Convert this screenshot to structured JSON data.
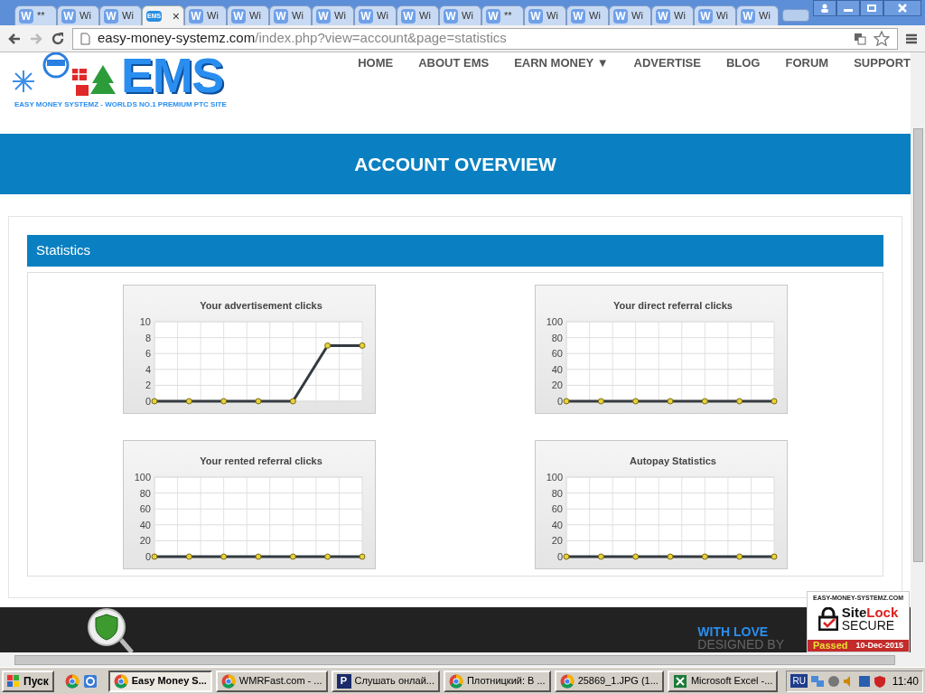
{
  "browser": {
    "tabs": [
      {
        "icon": "W",
        "label": "**",
        "selected": false
      },
      {
        "icon": "W",
        "label": "Wi",
        "selected": false
      },
      {
        "icon": "W",
        "label": "Wi",
        "selected": false
      },
      {
        "icon": "EMS",
        "close": "×",
        "selected": true
      },
      {
        "icon": "W",
        "label": "Wi",
        "selected": false
      },
      {
        "icon": "W",
        "label": "Wi",
        "selected": false
      },
      {
        "icon": "W",
        "label": "Wi",
        "selected": false
      },
      {
        "icon": "W",
        "label": "Wi",
        "selected": false
      },
      {
        "icon": "W",
        "label": "Wi",
        "selected": false
      },
      {
        "icon": "W",
        "label": "Wi",
        "selected": false
      },
      {
        "icon": "W",
        "label": "Wi",
        "selected": false
      },
      {
        "icon": "W",
        "label": "**",
        "selected": false
      },
      {
        "icon": "W",
        "label": "Wi",
        "selected": false
      },
      {
        "icon": "W",
        "label": "Wi",
        "selected": false
      },
      {
        "icon": "W",
        "label": "Wi",
        "selected": false
      },
      {
        "icon": "W",
        "label": "Wi",
        "selected": false
      },
      {
        "icon": "W",
        "label": "Wi",
        "selected": false
      },
      {
        "icon": "W",
        "label": "Wi",
        "selected": false
      }
    ],
    "url_host": "easy-money-systemz.com",
    "url_path": "/index.php?view=account&page=statistics"
  },
  "site": {
    "logo": {
      "title": "EMS",
      "tagline": "EASY MONEY SYSTEMZ - WORLDS NO.1 PREMIUM PTC SITE"
    },
    "nav": [
      {
        "label": "HOME"
      },
      {
        "label": "ABOUT EMS"
      },
      {
        "label": "EARN MONEY ▼"
      },
      {
        "label": "ADVERTISE"
      },
      {
        "label": "BLOG"
      },
      {
        "label": "FORUM"
      },
      {
        "label": "SUPPORT"
      }
    ],
    "banner": "ACCOUNT OVERVIEW",
    "section_title": "Statistics",
    "charts": [
      {
        "chart_data": {
          "type": "line",
          "title": "Your advertisement clicks",
          "grid": true,
          "ylim": [
            0,
            10
          ],
          "yticks": [
            0,
            2,
            4,
            6,
            8,
            10
          ],
          "series": [
            {
              "color": "#333a40",
              "marker": true,
              "values": [
                0,
                0,
                0,
                0,
                0,
                7,
                7
              ]
            }
          ]
        }
      },
      {
        "chart_data": {
          "type": "line",
          "title": "Your direct referral clicks",
          "grid": true,
          "ylim": [
            0,
            100
          ],
          "yticks": [
            0,
            20,
            40,
            60,
            80,
            100
          ],
          "series": [
            {
              "color": "#333a40",
              "marker": true,
              "values": [
                0,
                0,
                0,
                0,
                0,
                0,
                0
              ]
            }
          ]
        }
      },
      {
        "chart_data": {
          "type": "line",
          "title": "Your rented referral clicks",
          "grid": true,
          "ylim": [
            0,
            100
          ],
          "yticks": [
            0,
            20,
            40,
            60,
            80,
            100
          ],
          "series": [
            {
              "color": "#333a40",
              "marker": true,
              "values": [
                0,
                0,
                0,
                0,
                0,
                0,
                0
              ]
            }
          ]
        }
      },
      {
        "chart_data": {
          "type": "line",
          "title": "Autopay Statistics",
          "grid": true,
          "ylim": [
            0,
            100
          ],
          "yticks": [
            0,
            20,
            40,
            60,
            80,
            100
          ],
          "series": [
            {
              "color": "#333a40",
              "marker": true,
              "values": [
                0,
                0,
                0,
                0,
                0,
                0,
                0
              ]
            }
          ]
        }
      }
    ],
    "footer": {
      "line1": "WITH LOVE",
      "line2": "DESIGNED BY"
    },
    "sitelock": {
      "domain": "EASY-MONEY-SYSTEMZ.COM",
      "brand_a": "Site",
      "brand_b": "Lock",
      "secure": "SECURE",
      "status": "Passed",
      "date": "10-Dec-2015"
    }
  },
  "taskbar": {
    "start": "Пуск",
    "tasks": [
      {
        "kind": "chrome",
        "label": "Easy Money S...",
        "selected": true
      },
      {
        "kind": "chrome",
        "label": "WMRFast.com - ...",
        "selected": false
      },
      {
        "kind": "p",
        "icon": "P",
        "label": "Слушать онлай...",
        "selected": false
      },
      {
        "kind": "chrome",
        "label": "Плотницкий: В ...",
        "selected": false
      },
      {
        "kind": "chrome",
        "label": "25869_1.JPG (1...",
        "selected": false
      },
      {
        "kind": "excel",
        "label": "Microsoft Excel -...",
        "selected": false
      }
    ],
    "language": "RU",
    "clock": "11:40"
  }
}
